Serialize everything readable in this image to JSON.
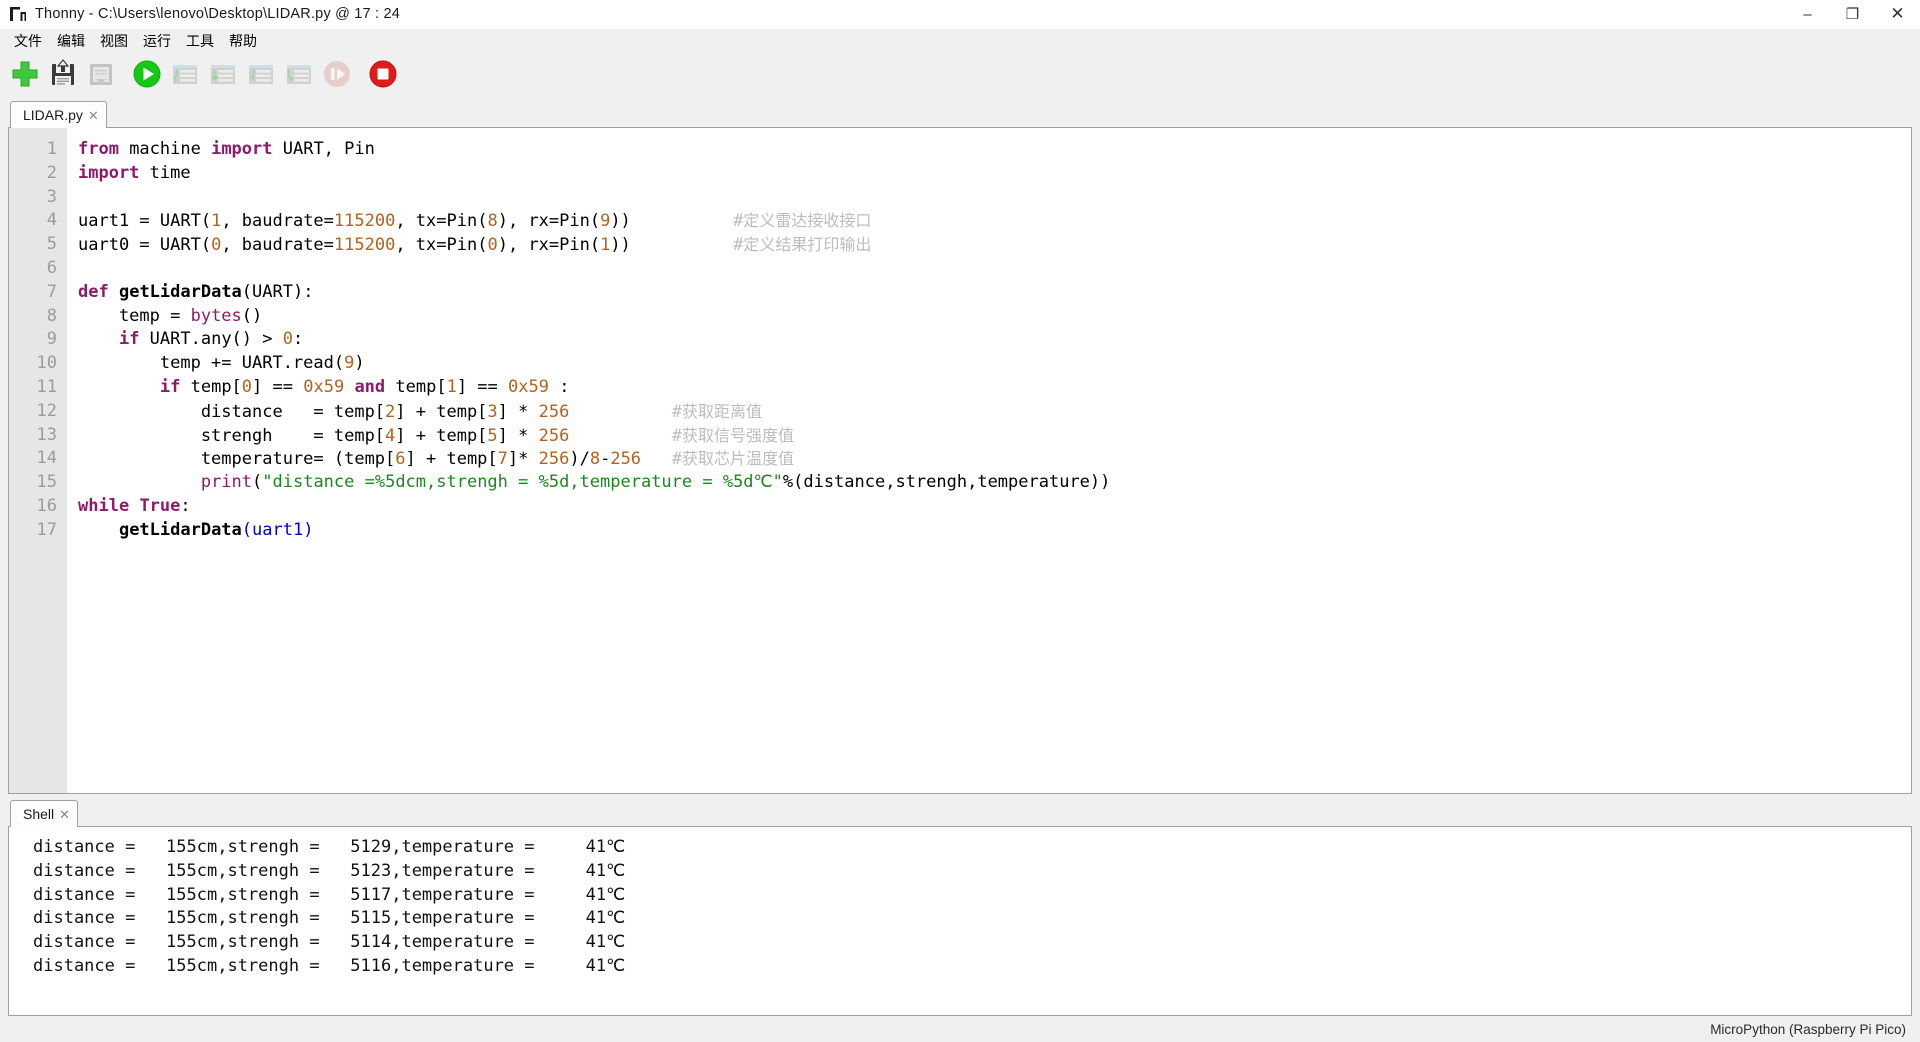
{
  "window": {
    "app_icon": "thonny-icon",
    "title": "Thonny  -  C:\\Users\\lenovo\\Desktop\\LIDAR.py @ 17 : 24",
    "minimize": "–",
    "maximize": "❐",
    "close": "✕"
  },
  "menu": {
    "items": [
      {
        "label": "文件",
        "name": "menu-file"
      },
      {
        "label": "编辑",
        "name": "menu-edit"
      },
      {
        "label": "视图",
        "name": "menu-view"
      },
      {
        "label": "运行",
        "name": "menu-run"
      },
      {
        "label": "工具",
        "name": "menu-tools"
      },
      {
        "label": "帮助",
        "name": "menu-help"
      }
    ]
  },
  "toolbar": {
    "buttons": [
      {
        "name": "new-file-button",
        "icon": "plus-icon",
        "enabled": true
      },
      {
        "name": "save-file-button",
        "icon": "save-icon",
        "enabled": true
      },
      {
        "name": "load-file-button",
        "icon": "load-icon",
        "enabled": false
      },
      {
        "name": "run-button",
        "icon": "play-icon",
        "enabled": true
      },
      {
        "name": "debug-button",
        "icon": "debug-icon",
        "enabled": false
      },
      {
        "name": "step-over-button",
        "icon": "step-over-icon",
        "enabled": false
      },
      {
        "name": "step-into-button",
        "icon": "step-into-icon",
        "enabled": false
      },
      {
        "name": "step-out-button",
        "icon": "step-out-icon",
        "enabled": false
      },
      {
        "name": "resume-button",
        "icon": "resume-icon",
        "enabled": false
      },
      {
        "name": "stop-button",
        "icon": "stop-icon",
        "enabled": true
      }
    ]
  },
  "editor": {
    "tab": {
      "label": "LIDAR.py",
      "close": "✕"
    },
    "line_numbers": [
      "1",
      "2",
      "3",
      "4",
      "5",
      "6",
      "7",
      "8",
      "9",
      "10",
      "11",
      "12",
      "13",
      "14",
      "15",
      "16",
      "17"
    ],
    "lines": [
      "from machine import UART, Pin",
      "import time",
      "",
      "uart1 = UART(1, baudrate=115200, tx=Pin(8), rx=Pin(9))          #定义雷达接收接口",
      "uart0 = UART(0, baudrate=115200, tx=Pin(0), rx=Pin(1))          #定义结果打印输出",
      "",
      "def getLidarData(UART):",
      "    temp = bytes()",
      "    if UART.any() > 0:",
      "        temp += UART.read(9)",
      "        if temp[0] == 0x59 and temp[1] == 0x59 :",
      "            distance   = temp[2] + temp[3] * 256          #获取距离值",
      "            strengh    = temp[4] + temp[5] * 256          #获取信号强度值",
      "            temperature= (temp[6] + temp[7]* 256)/8-256   #获取芯片温度值",
      "            print(\"distance =%5dcm,strengh = %5d,temperature = %5d℃\"%(distance,strengh,temperature))",
      "while True:",
      "    getLidarData(uart1)"
    ],
    "comments": [
      "#定义雷达接收接口",
      "#定义结果打印输出",
      "#获取距离值",
      "#获取信号强度值",
      "#获取芯片温度值"
    ]
  },
  "shell": {
    "tab": {
      "label": "Shell",
      "close": "✕"
    },
    "output_lines": [
      "distance =   155cm,strengh =   5129,temperature =     41℃",
      "distance =   155cm,strengh =   5123,temperature =     41℃",
      "distance =   155cm,strengh =   5117,temperature =     41℃",
      "distance =   155cm,strengh =   5115,temperature =     41℃",
      "distance =   155cm,strengh =   5114,temperature =     41℃",
      "distance =   155cm,strengh =   5116,temperature =     41℃"
    ]
  },
  "statusbar": {
    "interpreter": "MicroPython (Raspberry Pi Pico)"
  },
  "colors": {
    "keyword": "#8f1a6b",
    "number": "#b4621c",
    "string": "#1a8a1a",
    "comment": "#bdbdbd",
    "accent_green": "#2fbf3f",
    "accent_red": "#d81b1b",
    "gutter_bg": "#e6e6e6",
    "chrome_bg": "#f0f0f0"
  }
}
